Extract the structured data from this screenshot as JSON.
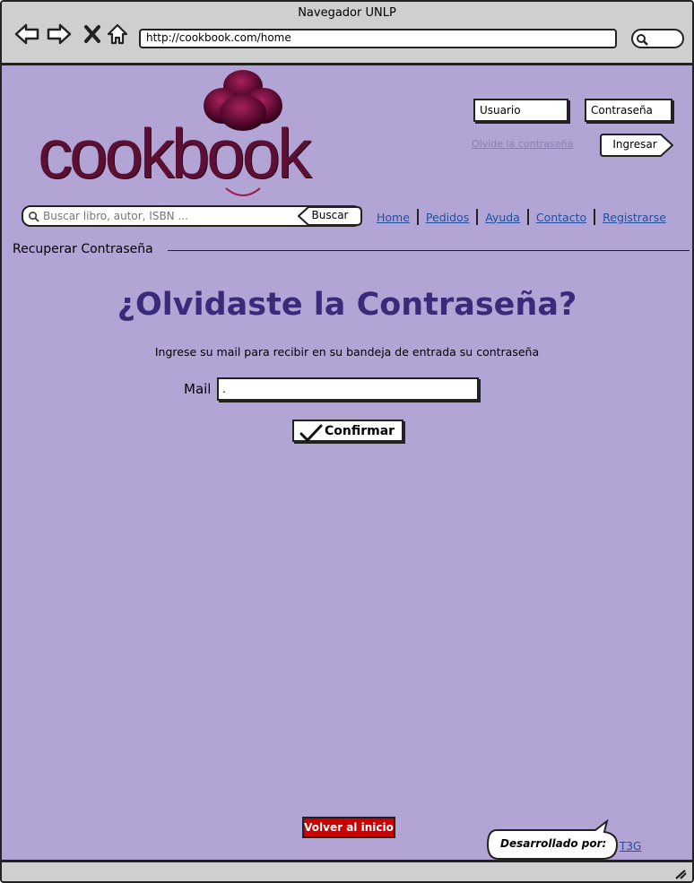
{
  "window": {
    "title": "Navegador UNLP",
    "url": "http://cookbook.com/home"
  },
  "header": {
    "logo_text": "cookbook",
    "login": {
      "user_placeholder": "Usuario",
      "password_placeholder": "Contraseña",
      "forgot_link": "Olvide la contraseña",
      "login_button": "Ingresar"
    },
    "search": {
      "placeholder": "Buscar libro, autor, ISBN ...",
      "button": "Buscar"
    },
    "nav": {
      "home": "Home",
      "pedidos": "Pedidos",
      "ayuda": "Ayuda",
      "contacto": "Contacto",
      "registrarse": "Registrarse"
    }
  },
  "main": {
    "section_title": "Recuperar Contraseña",
    "headline": "¿Olvidaste la Contraseña?",
    "instructions": "Ingrese su mail para recibir en su bandeja de entrada su contraseña",
    "mail_label": "Mail",
    "mail_value": ".",
    "confirm_button": "Confirmar"
  },
  "footer": {
    "back_button": "Volver al inicio",
    "developed_by": "Desarrollado por:",
    "developer_link": "T3G"
  },
  "colors": {
    "page_background": "#b3a4d6",
    "headline": "#3a2a7a",
    "link": "#1f4f9c",
    "logo": "#5a0f33",
    "back_button": "#cc0000"
  }
}
